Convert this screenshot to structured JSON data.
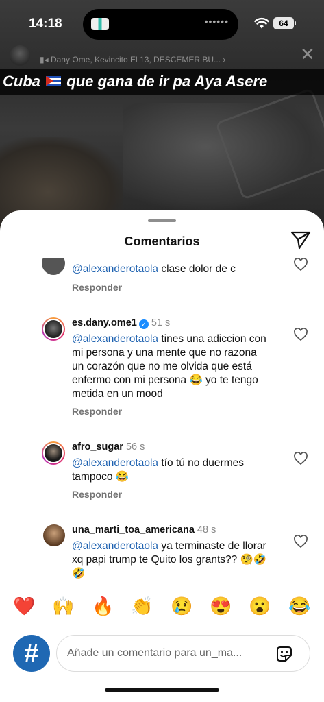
{
  "status_bar": {
    "time": "14:18",
    "battery": "64"
  },
  "story": {
    "username": "",
    "music": "Dany Ome, Kevincito El 13, DESCEMER BU... ›",
    "caption_start": "Cuba",
    "caption_end": "que gana de ir pa Aya Asere"
  },
  "sheet": {
    "title": "Comentarios"
  },
  "comments": [
    {
      "username": "",
      "time": "",
      "mention": "@alexanderotaola",
      "text": " clase dolor de c",
      "reply": "Responder"
    },
    {
      "username": "es.dany.ome1",
      "time": "51 s",
      "verified": true,
      "mention": "@alexanderotaola",
      "text": " tines una adiccion con mi persona y una mente que no razona un corazón que no me olvida que está enfermo con mi persona 😂 yo te tengo metida en un mood",
      "reply": "Responder"
    },
    {
      "username": "afro_sugar",
      "time": "56 s",
      "mention": "@alexanderotaola",
      "text": " tío tú no duermes tampoco 😂",
      "reply": "Responder"
    },
    {
      "username": "una_marti_toa_americana",
      "time": "48 s",
      "mention": "@alexanderotaola",
      "text": " ya terminaste de llorar xq papi trump te Quito los grants?? 🧐🤣🤣",
      "reply": ""
    }
  ],
  "reactions": [
    "❤️",
    "🙌",
    "🔥",
    "👏",
    "😢",
    "😍",
    "😮",
    "😂"
  ],
  "input": {
    "placeholder": "Añade un comentario para un_ma..."
  },
  "icons": {
    "send": "paper-plane-icon",
    "heart": "heart-outline-icon",
    "sticker": "sticker-icon",
    "wifi": "wifi-icon",
    "close": "close-icon",
    "music": "music-icon"
  }
}
